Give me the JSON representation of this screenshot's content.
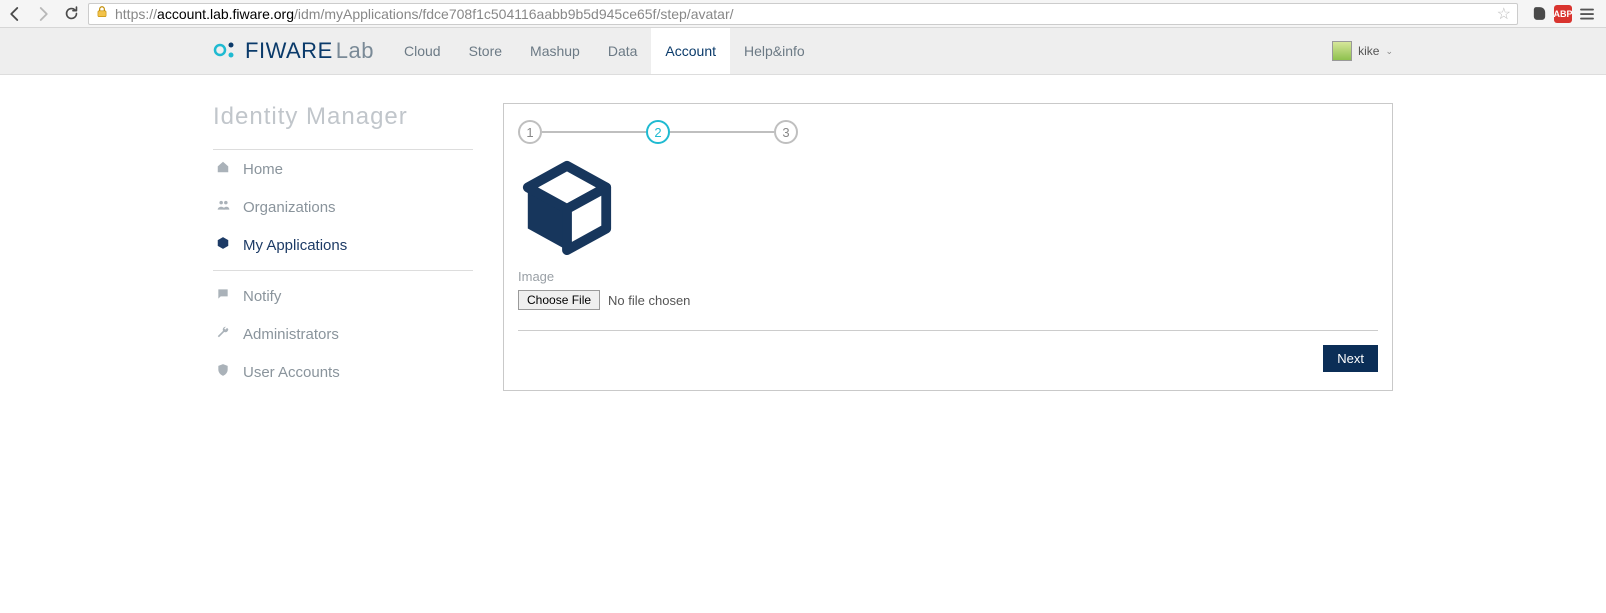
{
  "browser": {
    "url_host": "account.lab.fiware.org",
    "url_path": "/idm/myApplications/fdce708f1c504116aabb9b5d945ce65f/step/avatar/",
    "url_scheme": "https://"
  },
  "topnav": {
    "links": [
      {
        "label": "Cloud"
      },
      {
        "label": "Store"
      },
      {
        "label": "Mashup"
      },
      {
        "label": "Data"
      },
      {
        "label": "Account",
        "active": true
      },
      {
        "label": "Help&info"
      }
    ],
    "user": "kike"
  },
  "logo": {
    "fi": "FI",
    "ware": "WARE",
    "lab": "Lab"
  },
  "sidebar": {
    "title": "Identity Manager",
    "groups": [
      [
        {
          "label": "Home"
        },
        {
          "label": "Organizations"
        },
        {
          "label": "My Applications",
          "active": true
        }
      ],
      [
        {
          "label": "Notify"
        },
        {
          "label": "Administrators"
        },
        {
          "label": "User Accounts"
        }
      ]
    ]
  },
  "stepper": {
    "steps": [
      "1",
      "2",
      "3"
    ],
    "active_index": 1
  },
  "form": {
    "image_label": "Image",
    "choose_file": "Choose File",
    "file_status": "No file chosen",
    "next": "Next"
  }
}
